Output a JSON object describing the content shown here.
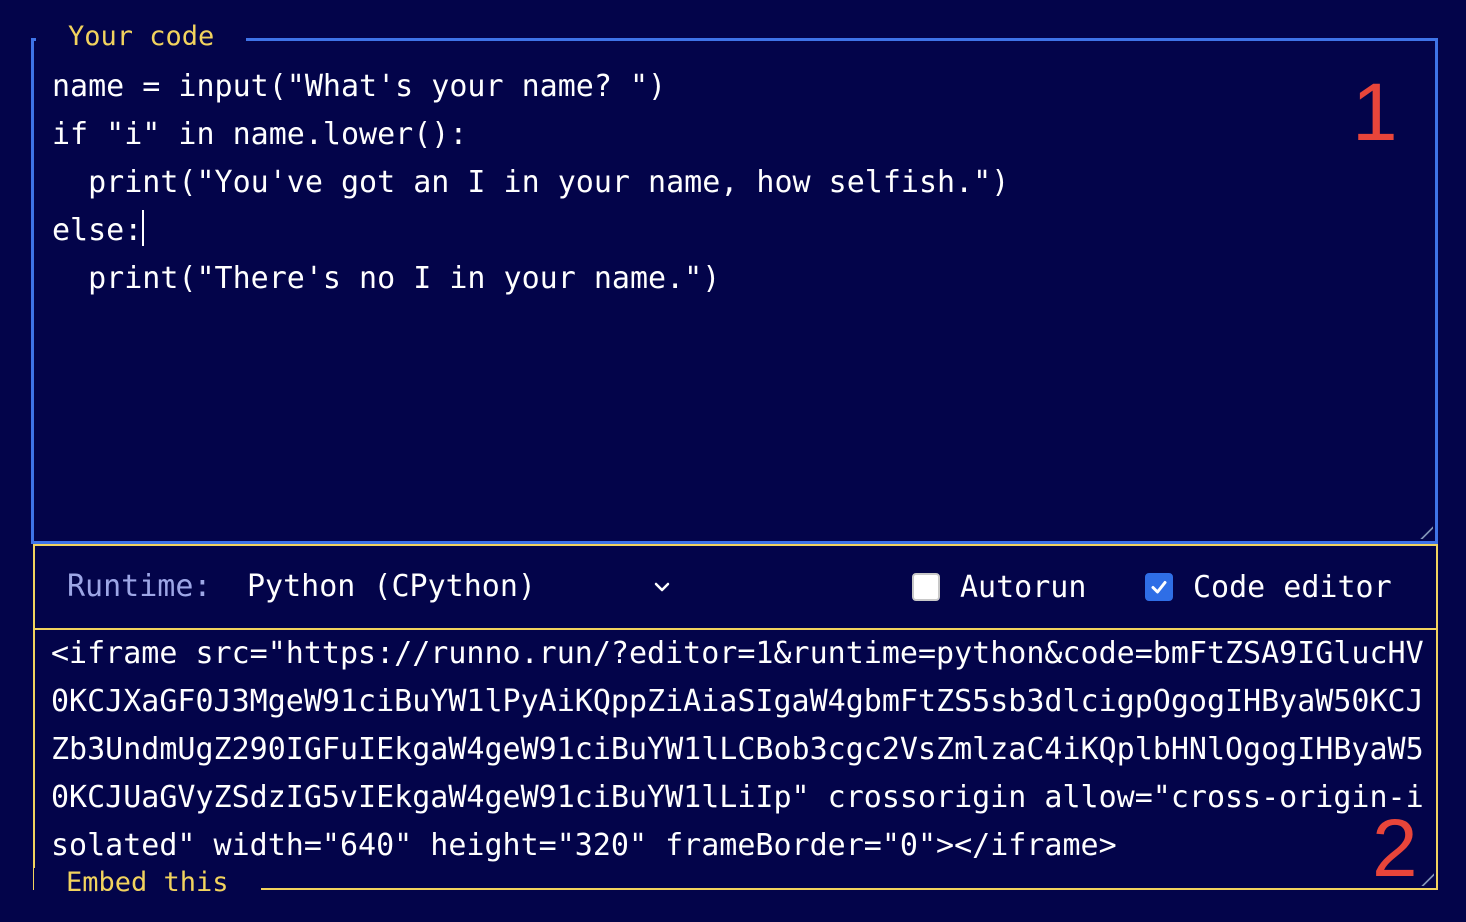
{
  "code_section": {
    "legend": "Your code",
    "lines": [
      "name = input(\"What's your name? \")",
      "if \"i\" in name.lower():",
      "  print(\"You've got an I in your name, how selfish.\")",
      "else:",
      "  print(\"There's no I in your name.\")"
    ],
    "marker": "1"
  },
  "controls": {
    "runtime_label": "Runtime:",
    "runtime_value": "Python (CPython)",
    "autorun_label": "Autorun",
    "autorun_checked": false,
    "code_editor_label": "Code editor",
    "code_editor_checked": true
  },
  "embed_section": {
    "legend": "Embed this",
    "snippet": "<iframe src=\"https://runno.run/?editor=1&runtime=python&code=bmFtZSA9IGlucHV0KCJXaGF0J3MgeW91ciBuYW1lPyAiKQppZiAiaSIgaW4gbmFtZS5sb3dlcigpOgogIHByaW50KCJZb3UndmUgZ290IGFuIEkgaW4geW91ciBuYW1lLCBob3cgc2VsZmlzaC4iKQplbHNlOgogIHByaW50KCJUaGVyZSdzIG5vIEkgaW4geW91ciBuYW1lLiIp\" crossorigin allow=\"cross-origin-isolated\" width=\"640\" height=\"320\" frameBorder=\"0\"></iframe>",
    "marker": "2"
  },
  "colors": {
    "background": "#03044a",
    "code_border": "#3f74e8",
    "accent_yellow": "#f2d35e",
    "marker_red": "#e8453a"
  }
}
